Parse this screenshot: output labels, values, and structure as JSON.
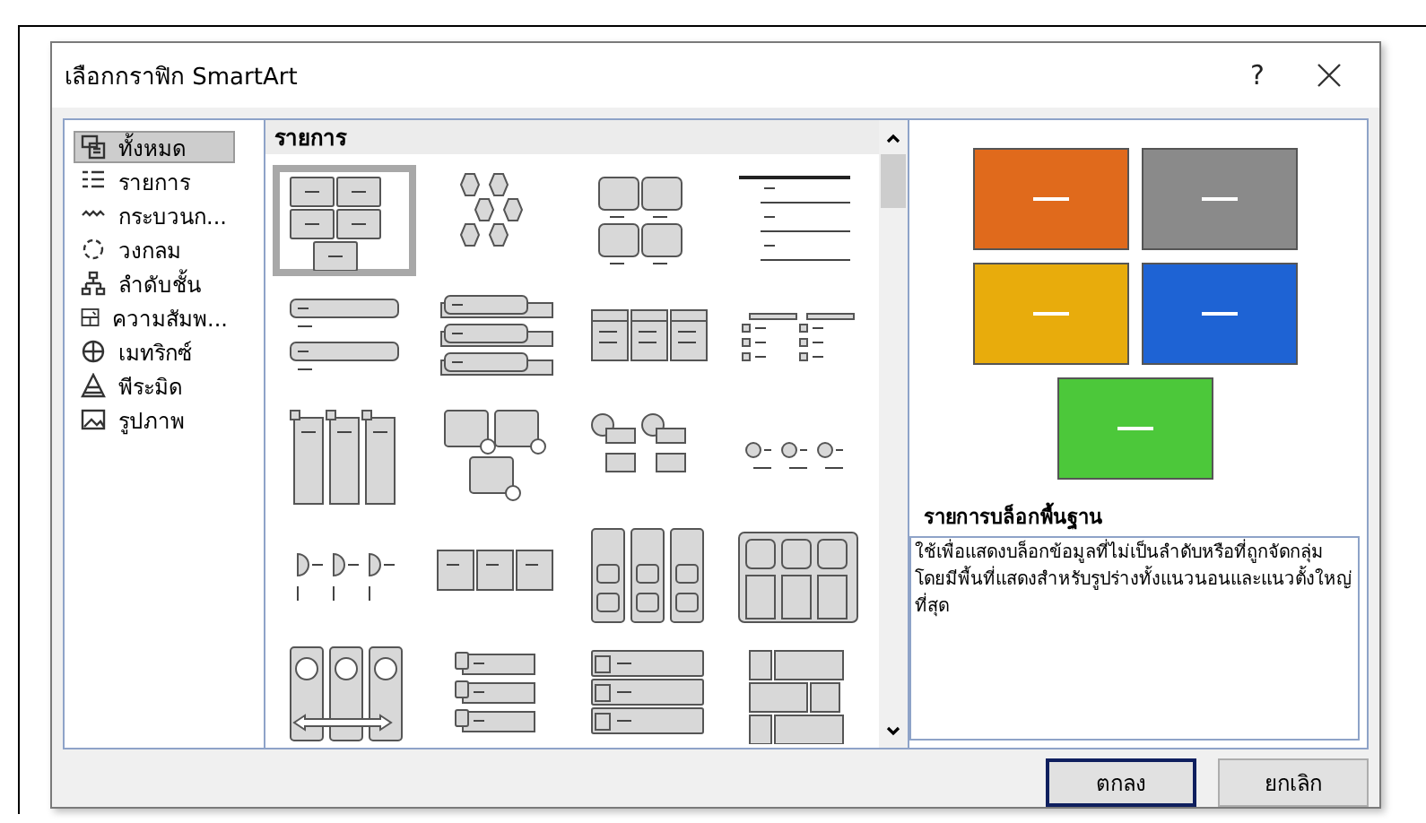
{
  "window": {
    "title": "เลือกกราฟิก SmartArt",
    "help": "?"
  },
  "categories": [
    {
      "label": "ทั้งหมด",
      "kind": "all",
      "selected": true
    },
    {
      "label": "รายการ",
      "kind": "list",
      "selected": false
    },
    {
      "label": "กระบวนก...",
      "kind": "process",
      "selected": false
    },
    {
      "label": "วงกลม",
      "kind": "cycle",
      "selected": false
    },
    {
      "label": "ลำดับชั้น",
      "kind": "hierarchy",
      "selected": false
    },
    {
      "label": "ความสัมพ...",
      "kind": "relationship",
      "selected": false
    },
    {
      "label": "เมทริกซ์",
      "kind": "matrix",
      "selected": false
    },
    {
      "label": "พีระมิด",
      "kind": "pyramid",
      "selected": false
    },
    {
      "label": "รูปภาพ",
      "kind": "picture",
      "selected": false
    }
  ],
  "gallery": {
    "heading": "รายการ",
    "items": [
      {
        "kind": "blocks",
        "selected": true
      },
      {
        "kind": "hexagons",
        "selected": false
      },
      {
        "kind": "quad",
        "selected": false
      },
      {
        "kind": "lines",
        "selected": false
      },
      {
        "kind": "bars",
        "selected": false
      },
      {
        "kind": "stacked",
        "selected": false
      },
      {
        "kind": "table",
        "selected": false
      },
      {
        "kind": "checklist",
        "selected": false
      },
      {
        "kind": "columns",
        "selected": false
      },
      {
        "kind": "cards",
        "selected": false
      },
      {
        "kind": "bubbles",
        "selected": false
      },
      {
        "kind": "dots",
        "selected": false
      },
      {
        "kind": "halfcircles",
        "selected": false
      },
      {
        "kind": "chevrons",
        "selected": false
      },
      {
        "kind": "pillars",
        "selected": false
      },
      {
        "kind": "panels",
        "selected": false
      },
      {
        "kind": "arrowcols",
        "selected": false
      },
      {
        "kind": "tabs",
        "selected": false
      },
      {
        "kind": "pictrows",
        "selected": false
      },
      {
        "kind": "brick",
        "selected": false
      }
    ]
  },
  "preview": {
    "title": "รายการบล็อกพื้นฐาน",
    "description": "ใช้เพื่อแสดงบล็อกข้อมูลที่ไม่เป็นลำดับหรือที่ถูกจัดกลุ่ม โดยมีพื้นที่แสดงสำหรับรูปร่างทั้งแนวนอนและแนวตั้งใหญ่ที่สุด"
  },
  "buttons": [
    {
      "label": "ตกลง",
      "default": true
    },
    {
      "label": "ยกเลิก",
      "default": false
    }
  ]
}
